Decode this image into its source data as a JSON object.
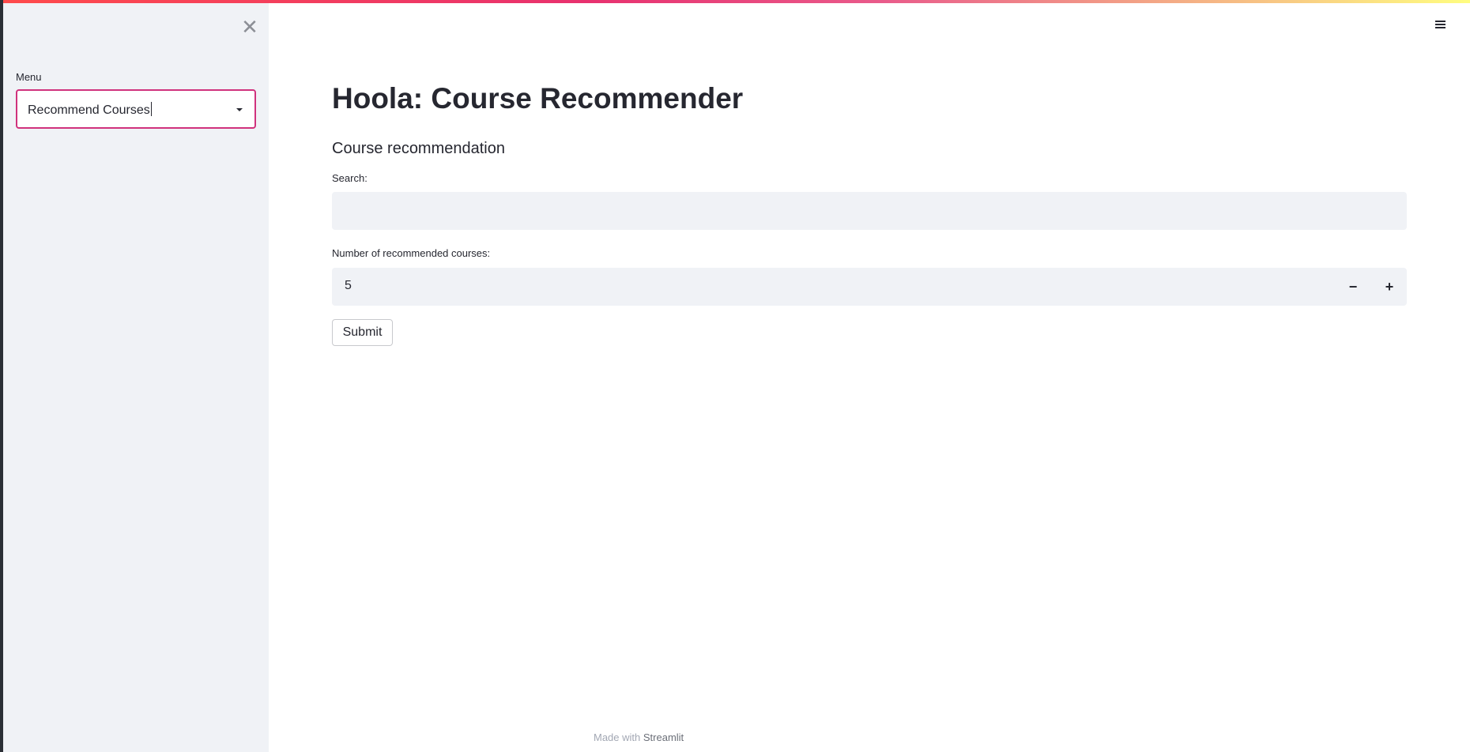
{
  "sidebar": {
    "menu_label": "Menu",
    "selected_option": "Recommend Courses",
    "close_icon": "close-icon"
  },
  "header": {
    "menu_icon": "hamburger-menu-icon"
  },
  "main": {
    "title": "Hoola: Course Recommender",
    "subtitle": "Course recommendation",
    "search_label": "Search:",
    "search_value": "",
    "count_label": "Number of recommended courses:",
    "count_value": "5",
    "decrement_label": "−",
    "increment_label": "+",
    "submit_label": "Submit"
  },
  "footer": {
    "prefix": "Made with ",
    "link": "Streamlit"
  },
  "colors": {
    "accent": "#d0327d",
    "sidebar_bg": "#f0f2f6",
    "text": "#262730"
  }
}
